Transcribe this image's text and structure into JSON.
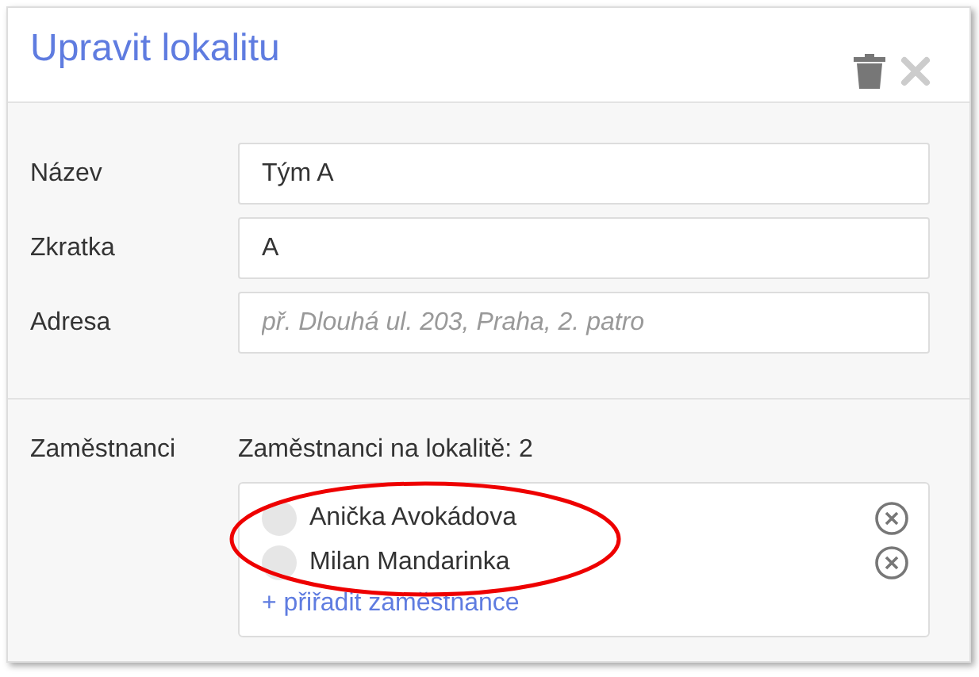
{
  "dialog": {
    "title": "Upravit lokalitu"
  },
  "fields": [
    {
      "label": "Název",
      "value": "Tým A"
    },
    {
      "label": "Zkratka",
      "value": "A"
    },
    {
      "label": "Adresa",
      "placeholder": "př. Dlouhá ul. 203, Praha, 2. patro"
    }
  ],
  "employees": {
    "label": "Zaměstnanci",
    "count_text": "Zaměstnanci na lokalitě: 2",
    "items": [
      {
        "name": "Anička Avokádova"
      },
      {
        "name": "Milan Mandarinka"
      }
    ],
    "add_link": "+ přiřadit zaměstnance"
  }
}
